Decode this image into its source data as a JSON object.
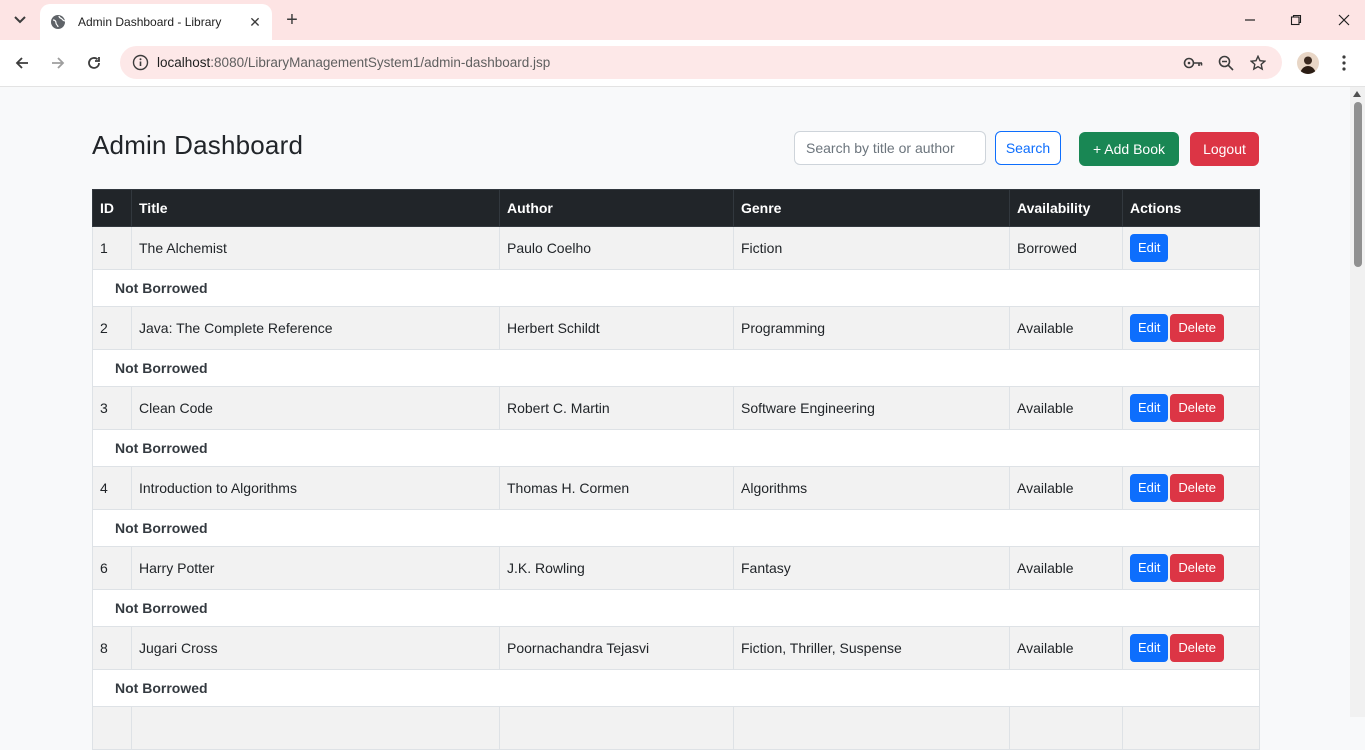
{
  "browser": {
    "tab_title": "Admin Dashboard - Library",
    "url_host": "localhost",
    "url_rest": ":8080/LibraryManagementSystem1/admin-dashboard.jsp"
  },
  "page": {
    "title": "Admin Dashboard",
    "search_placeholder": "Search by title or author",
    "search_value": "",
    "search_label": "Search",
    "add_label": "+ Add Book",
    "logout_label": "Logout"
  },
  "table": {
    "headers": [
      "ID",
      "Title",
      "Author",
      "Genre",
      "Availability",
      "Actions"
    ],
    "edit_label": "Edit",
    "delete_label": "Delete",
    "rows": [
      {
        "id": "1",
        "title": "The Alchemist",
        "author": "Paulo Coelho",
        "genre": "Fiction",
        "availability": "Borrowed",
        "status": "Not Borrowed",
        "can_delete": false
      },
      {
        "id": "2",
        "title": "Java: The Complete Reference",
        "author": "Herbert Schildt",
        "genre": "Programming",
        "availability": "Available",
        "status": "Not Borrowed",
        "can_delete": true
      },
      {
        "id": "3",
        "title": "Clean Code",
        "author": "Robert C. Martin",
        "genre": "Software Engineering",
        "availability": "Available",
        "status": "Not Borrowed",
        "can_delete": true
      },
      {
        "id": "4",
        "title": "Introduction to Algorithms",
        "author": "Thomas H. Cormen",
        "genre": "Algorithms",
        "availability": "Available",
        "status": "Not Borrowed",
        "can_delete": true
      },
      {
        "id": "6",
        "title": "Harry Potter",
        "author": "J.K. Rowling",
        "genre": "Fantasy",
        "availability": "Available",
        "status": "Not Borrowed",
        "can_delete": true
      },
      {
        "id": "8",
        "title": "Jugari Cross",
        "author": "Poornachandra Tejasvi",
        "genre": "Fiction, Thriller, Suspense",
        "availability": "Available",
        "status": "Not Borrowed",
        "can_delete": true
      }
    ]
  },
  "colors": {
    "tabbar": "#fde4e4",
    "header": "#212529",
    "primary": "#0d6efd",
    "success": "#198754",
    "danger": "#dc3545"
  }
}
